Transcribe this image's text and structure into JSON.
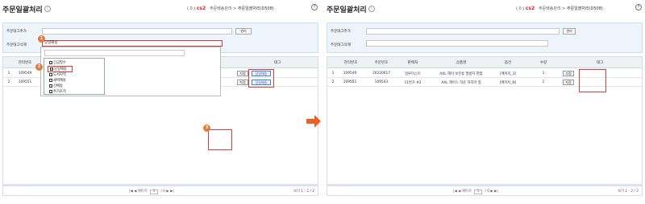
{
  "left": {
    "title": "주문일괄처리",
    "star": "☆",
    "crumbs": {
      "count": "( 0 )",
      "code": "cs2",
      "parent": "주문배송관리",
      "sep": ">",
      "current": "주문일괄처리(D508)"
    },
    "help": "?",
    "form": {
      "add_label": "주문태그추가",
      "del_label": "주문태그삭제",
      "del_value": "당일배송",
      "add_button": "관리"
    },
    "headers": [
      "관리번호",
      "태그"
    ],
    "rows": [
      {
        "num": "1",
        "id": "109549",
        "btn": "지정",
        "tag": "당일배송"
      },
      {
        "num": "2",
        "id": "109551",
        "btn": "지정",
        "tag": "당일배송"
      }
    ],
    "dropdown": {
      "items": [
        "긴급필수",
        "당일배송",
        "도서지역",
        "새벽배송",
        "선배송",
        "추가조치"
      ],
      "checked_index": 1
    },
    "badges": [
      "1",
      "2",
      "3"
    ],
    "pager": {
      "first": "|◀",
      "prev": "◀",
      "label": "페이지",
      "page": "1",
      "of": "/ 0",
      "next": "▶",
      "last": "▶|"
    },
    "view_count": "보기 1 - 2 / 2"
  },
  "right": {
    "title": "주문일괄처리",
    "star": "☆",
    "crumbs": {
      "count": "( 0 )",
      "code": "cs2",
      "parent": "주문배송관리",
      "sep": ">",
      "current": "주문일괄처리(D508)"
    },
    "help": "?",
    "form": {
      "add_label": "주문태그추가",
      "del_label": "주문태그삭제",
      "add_button": "관리"
    },
    "headers": [
      "관리번호",
      "주문번호",
      "판매처",
      "상품명",
      "옵션",
      "수량",
      "태그"
    ],
    "rows": [
      {
        "num": "1",
        "id": "109549",
        "order": "20220617",
        "seller": "일루미스트",
        "product": "AXL 헤어 보온용 필름지 편합",
        "option": "[메이지_3]",
        "qty": "1",
        "btn": "지정"
      },
      {
        "num": "2",
        "id": "109551",
        "order": "109543",
        "seller": "11번가 #2",
        "product": "AXL 헤어스 하운 허허미 형",
        "option": "[메이지_N]",
        "qty": "1",
        "btn": "지정"
      }
    ],
    "pager": {
      "first": "|◀",
      "prev": "◀",
      "label": "페이지",
      "page": "1",
      "of": "/ 0",
      "next": "▶",
      "last": "▶|"
    },
    "view_count": "보기 1 - 2 / 2"
  },
  "colors": {
    "accent_red": "#e03b3b",
    "badge_orange": "#e07a3f",
    "arrow": "#e8622c",
    "tag_blue": "#4a7fc9"
  }
}
